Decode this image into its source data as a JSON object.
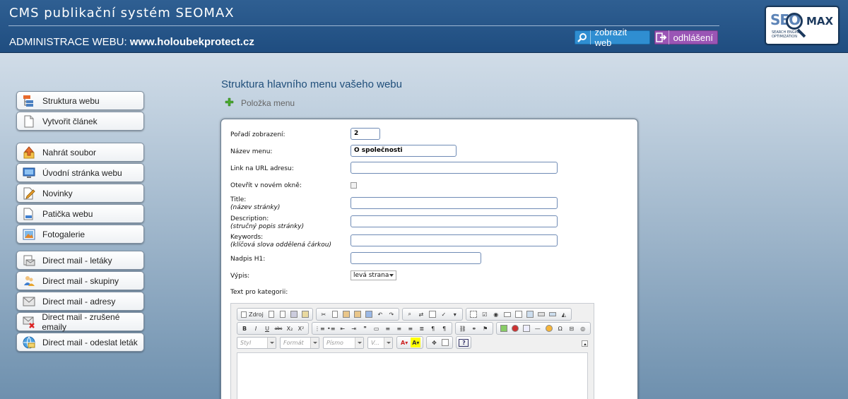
{
  "header": {
    "app_title": "CMS publikační systém SEOMAX",
    "admin_label": "ADMINISTRACE WEBU:",
    "site_domain": "www.holoubekprotect.cz",
    "view_site_label": "zobrazit web",
    "logout_label": "odhlášení",
    "logo_text_seo": "SEO",
    "logo_text_max": "MAX",
    "logo_tagline": "SEARCH ENGINE OPTIMIZATION"
  },
  "sidebar": {
    "group1": [
      {
        "label": "Struktura webu",
        "icon": "sitemap-icon"
      },
      {
        "label": "Vytvořit článek",
        "icon": "document-icon"
      }
    ],
    "group2": [
      {
        "label": "Nahrát soubor",
        "icon": "upload-icon"
      },
      {
        "label": "Úvodní stránka webu",
        "icon": "monitor-icon"
      },
      {
        "label": "Novinky",
        "icon": "pencil-document-icon"
      },
      {
        "label": "Patička webu",
        "icon": "footer-icon"
      },
      {
        "label": "Fotogalerie",
        "icon": "picture-icon"
      }
    ],
    "group3": [
      {
        "label": "Direct mail - letáky",
        "icon": "mail-flyer-icon"
      },
      {
        "label": "Direct mail - skupiny",
        "icon": "users-icon"
      },
      {
        "label": "Direct mail - adresy",
        "icon": "envelope-icon"
      },
      {
        "label": "Direct mail - zrušené emaily",
        "icon": "envelope-delete-icon"
      },
      {
        "label": "Direct mail - odeslat leták",
        "icon": "send-mail-icon"
      }
    ]
  },
  "main": {
    "title": "Struktura hlavního menu vašeho webu",
    "add_item_label": "Položka menu"
  },
  "form": {
    "order_label": "Pořadí zobrazení:",
    "order_value": "2",
    "name_label": "Název menu:",
    "name_value": "O společnosti",
    "url_label": "Link na URL adresu:",
    "url_value": "",
    "new_window_label": "Otevřít v novém okně:",
    "new_window_checked": false,
    "title_label": "Title:",
    "title_hint": "(název stránky)",
    "title_value": "",
    "description_label": "Description:",
    "description_hint": "(stručný popis stránky)",
    "description_value": "",
    "keywords_label": "Keywords:",
    "keywords_hint": "(klíčová slova oddělená čárkou)",
    "keywords_value": "",
    "h1_label": "Nadpis H1:",
    "h1_value": "",
    "listing_label": "Výpis:",
    "listing_value": "levá strana",
    "text_label": "Text pro kategorii:"
  },
  "editor": {
    "source_label": "Zdroj",
    "style_combo": "Styl",
    "format_combo": "Formát",
    "font_combo": "Písmo",
    "size_combo": "V...",
    "bold_label": "B",
    "italic_label": "I",
    "underline_label": "U",
    "strike_label": "abc",
    "subscript_label": "X₂",
    "superscript_label": "X²",
    "help_label": "?"
  }
}
